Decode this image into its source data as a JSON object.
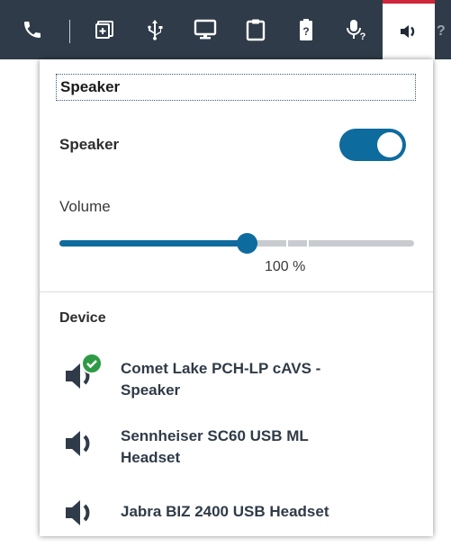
{
  "toolbar": {
    "icons": [
      "phone-icon",
      "add-window-icon",
      "usb-icon",
      "monitor-icon",
      "clipboard-icon",
      "battery-unknown-icon",
      "microphone-unknown-icon",
      "speaker-icon"
    ],
    "active": "speaker-icon",
    "accent_color": "#d0253b"
  },
  "panel": {
    "title": "Speaker",
    "speaker_toggle_label": "Speaker",
    "speaker_on": true,
    "volume_label": "Volume",
    "volume_percent": 100,
    "volume_value_text": "100 %",
    "device_header": "Device",
    "devices": [
      {
        "name_line1": "Comet Lake PCH-LP cAVS -",
        "name_line2": "Speaker",
        "selected": true
      },
      {
        "name_line1": "Sennheiser SC60 USB ML",
        "name_line2": "Headset",
        "selected": false
      },
      {
        "name_line1": "Jabra BIZ 2400 USB Headset",
        "name_line2": "",
        "selected": false
      }
    ]
  },
  "colors": {
    "toolbar_bg": "#2f3b48",
    "accent_blue": "#0e6b9e",
    "selected_check": "#2e9b44"
  }
}
